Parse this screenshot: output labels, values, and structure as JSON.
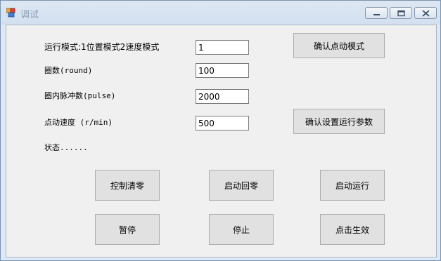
{
  "window": {
    "title": "调试"
  },
  "form": {
    "mode_label": "运行模式:1位置模式2速度模式",
    "mode_value": "1",
    "rounds_label": "圈数(round)",
    "rounds_value": "100",
    "pulse_label": "圈内脉冲数(pulse)",
    "pulse_value": "2000",
    "jog_speed_label": "点动速度 (r/min)",
    "jog_speed_value": "500",
    "status_label": "状态......"
  },
  "buttons": {
    "confirm_jog_mode": "确认点动模式",
    "confirm_run_params": "确认设置运行参数",
    "control_clear": "控制清零",
    "start_home": "启动回零",
    "start_run": "启动运行",
    "pause": "暂停",
    "stop": "停止",
    "click_apply": "点击生效"
  },
  "icons": {
    "app": "app-icon",
    "minimize": "minimize-icon",
    "maximize": "maximize-icon",
    "close": "close-icon"
  }
}
